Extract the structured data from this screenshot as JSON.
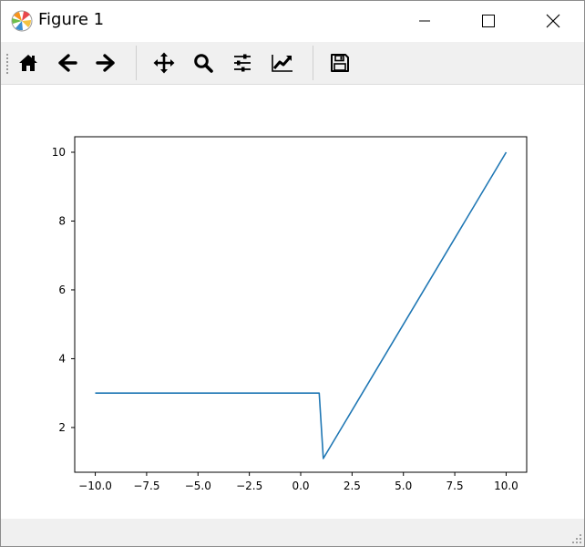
{
  "window": {
    "title": "Figure 1",
    "app_icon": "matplotlib-logo-icon",
    "controls": [
      "minimize-icon",
      "maximize-icon",
      "close-icon"
    ]
  },
  "toolbar": {
    "buttons": [
      {
        "name": "home-button",
        "icon": "home-icon"
      },
      {
        "name": "back-button",
        "icon": "arrow-left-icon"
      },
      {
        "name": "forward-button",
        "icon": "arrow-right-icon"
      },
      {
        "name": "pan-button",
        "icon": "move-arrows-icon"
      },
      {
        "name": "zoom-button",
        "icon": "magnifier-icon"
      },
      {
        "name": "subplots-button",
        "icon": "sliders-icon"
      },
      {
        "name": "edit-axes-button",
        "icon": "line-chart-icon"
      },
      {
        "name": "save-button",
        "icon": "floppy-disk-icon"
      }
    ]
  },
  "status": {
    "message": ""
  },
  "colors": {
    "line": "#1f77b4",
    "axes": "#000000",
    "toolbar_bg": "#f0f0f0"
  },
  "chart_data": {
    "type": "line",
    "title": "",
    "xlabel": "",
    "ylabel": "",
    "xlim": [
      -11.0,
      11.0
    ],
    "ylim": [
      0.7,
      10.45
    ],
    "xticks": [
      -10.0,
      -7.5,
      -5.0,
      -2.5,
      0.0,
      2.5,
      5.0,
      7.5,
      10.0
    ],
    "xtick_labels": [
      "−10.0",
      "−7.5",
      "−5.0",
      "−2.5",
      "0.0",
      "2.5",
      "5.0",
      "7.5",
      "10.0"
    ],
    "yticks": [
      2,
      4,
      6,
      8,
      10
    ],
    "ytick_labels": [
      "2",
      "4",
      "6",
      "8",
      "10"
    ],
    "grid": false,
    "series": [
      {
        "x": [
          -10.0,
          0.9,
          1.1,
          10.0
        ],
        "y": [
          3.0,
          3.0,
          1.1,
          10.0
        ]
      }
    ]
  }
}
